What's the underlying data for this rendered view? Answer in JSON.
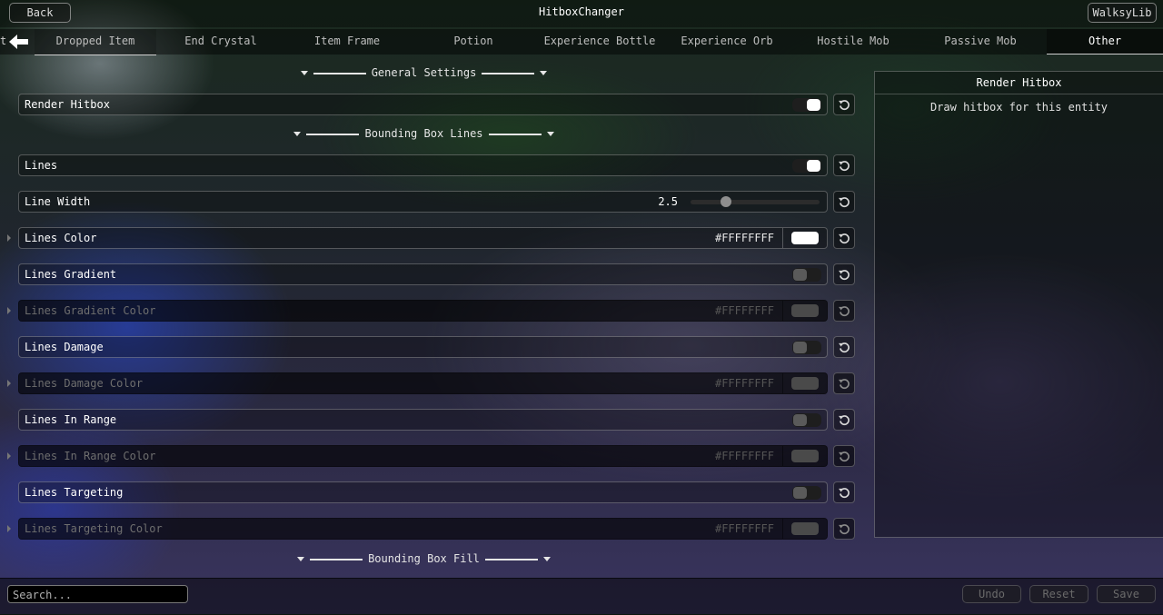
{
  "header": {
    "back_label": "Back",
    "title": "HitboxChanger",
    "lib_label": "WalksyLib"
  },
  "tabs": {
    "left_fragment": "t",
    "items": [
      {
        "label": "Dropped Item"
      },
      {
        "label": "End Crystal"
      },
      {
        "label": "Item Frame"
      },
      {
        "label": "Potion"
      },
      {
        "label": "Experience Bottle"
      },
      {
        "label": "Experience Orb"
      },
      {
        "label": "Hostile Mob"
      },
      {
        "label": "Passive Mob"
      },
      {
        "label": "Other"
      }
    ],
    "active": "Other"
  },
  "sections": {
    "general": "General Settings",
    "lines": "Bounding Box Lines",
    "fill": "Bounding Box Fill"
  },
  "settings": {
    "render_hitbox": {
      "label": "Render Hitbox",
      "enabled": true
    },
    "lines": {
      "label": "Lines",
      "enabled": true
    },
    "line_width": {
      "label": "Line Width",
      "value": "2.5",
      "fraction": 0.25
    },
    "lines_color": {
      "label": "Lines Color",
      "hex": "#FFFFFFFF"
    },
    "lines_gradient": {
      "label": "Lines Gradient",
      "enabled": false
    },
    "lines_gradient_color": {
      "label": "Lines Gradient Color",
      "hex": "#FFFFFFFF"
    },
    "lines_damage": {
      "label": "Lines Damage",
      "enabled": false
    },
    "lines_damage_color": {
      "label": "Lines Damage Color",
      "hex": "#FFFFFFFF"
    },
    "lines_in_range": {
      "label": "Lines In Range",
      "enabled": false
    },
    "lines_in_range_color": {
      "label": "Lines In Range Color",
      "hex": "#FFFFFFFF"
    },
    "lines_targeting": {
      "label": "Lines Targeting",
      "enabled": false
    },
    "lines_targeting_color": {
      "label": "Lines Targeting Color",
      "hex": "#FFFFFFFF"
    }
  },
  "info_panel": {
    "title": "Render Hitbox",
    "description": "Draw hitbox for this entity"
  },
  "footer": {
    "search_placeholder": "Search...",
    "undo_label": "Undo",
    "reset_label": "Reset",
    "save_label": "Save"
  },
  "colors": {
    "toggle_on": "#ffffff",
    "toggle_off": "#5a5a5a"
  }
}
